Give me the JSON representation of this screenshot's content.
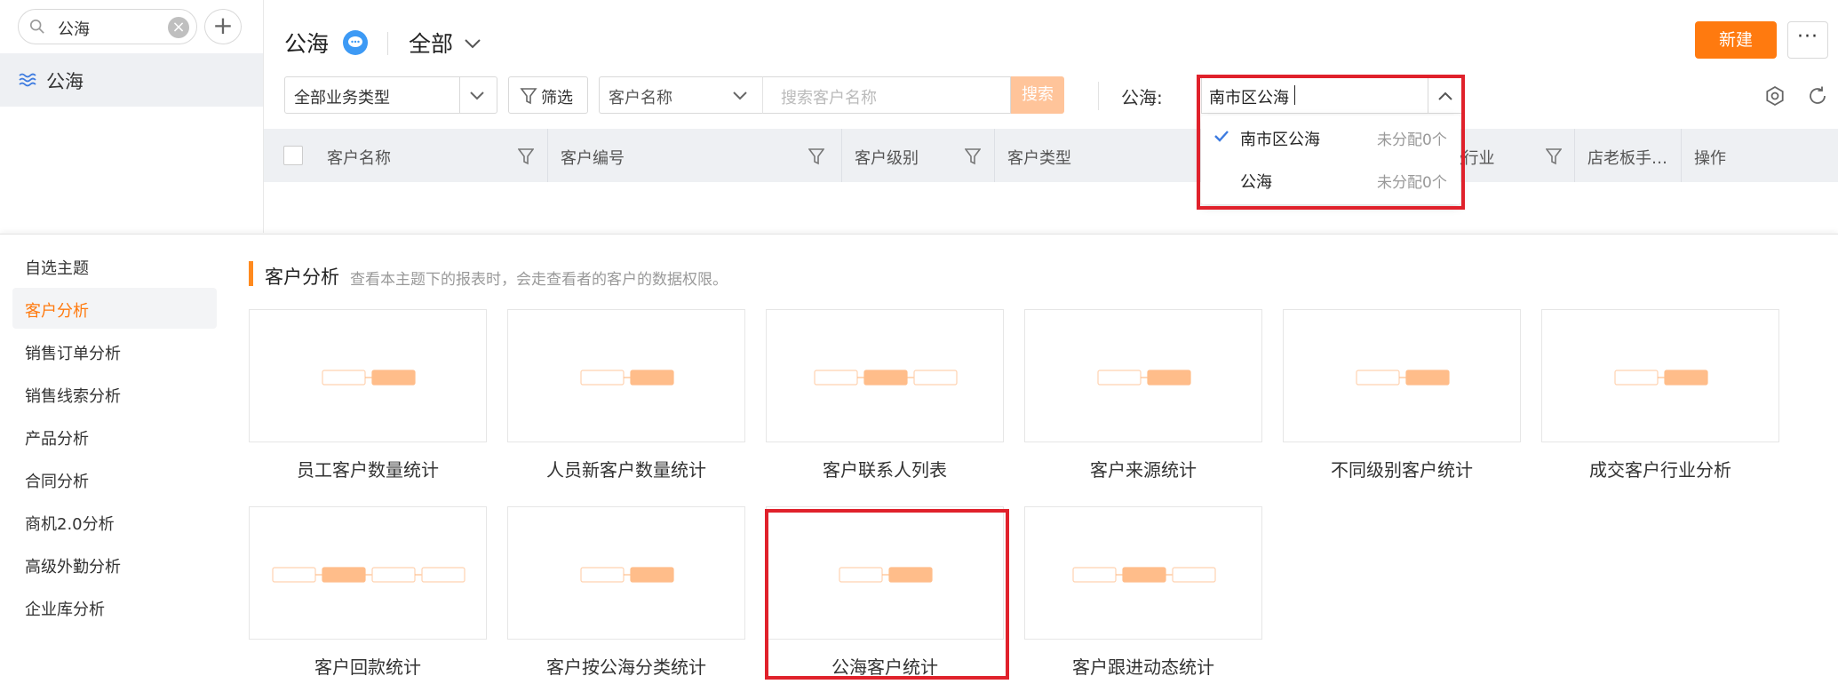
{
  "sidebar": {
    "search_value": "公海",
    "items": [
      {
        "label": "公海",
        "icon": "waves-icon"
      }
    ]
  },
  "header": {
    "title": "公海",
    "view_label": "全部",
    "new_button": "新建",
    "more_button": "···"
  },
  "filters": {
    "business_type": "全部业务类型",
    "filter_button": "筛选",
    "field_select": "客户名称",
    "search_placeholder": "搜索客户名称",
    "search_button": "搜索",
    "pool_label": "公海:",
    "pool_value": "南市区公海"
  },
  "pool_dropdown": {
    "options": [
      {
        "name": "南市区公海",
        "count": "未分配0个",
        "selected": true
      },
      {
        "name": "公海",
        "count": "未分配0个",
        "selected": false
      }
    ]
  },
  "table": {
    "columns": [
      "客户名称",
      "客户编号",
      "客户级别",
      "客户类型",
      "2级行业",
      "店老板手…",
      "操作"
    ]
  },
  "report_menu": {
    "items": [
      "自选主题",
      "客户分析",
      "销售订单分析",
      "销售线索分析",
      "产品分析",
      "合同分析",
      "商机2.0分析",
      "高级外勤分析",
      "企业库分析"
    ],
    "active_index": 1
  },
  "report_section": {
    "title": "客户分析",
    "description": "查看本主题下的报表时，会走查看者的客户的数据权限。",
    "cards": [
      {
        "label": "员工客户数量统计"
      },
      {
        "label": "人员新客户数量统计"
      },
      {
        "label": "客户联系人列表"
      },
      {
        "label": "客户来源统计"
      },
      {
        "label": "不同级别客户统计"
      },
      {
        "label": "成交客户行业分析"
      },
      {
        "label": "客户回款统计"
      },
      {
        "label": "客户按公海分类统计"
      },
      {
        "label": "公海客户统计"
      },
      {
        "label": "客户跟进动态统计"
      }
    ]
  },
  "colors": {
    "accent": "#ff7a0f",
    "highlight": "#e0212b",
    "badge": "#3d9af5"
  }
}
